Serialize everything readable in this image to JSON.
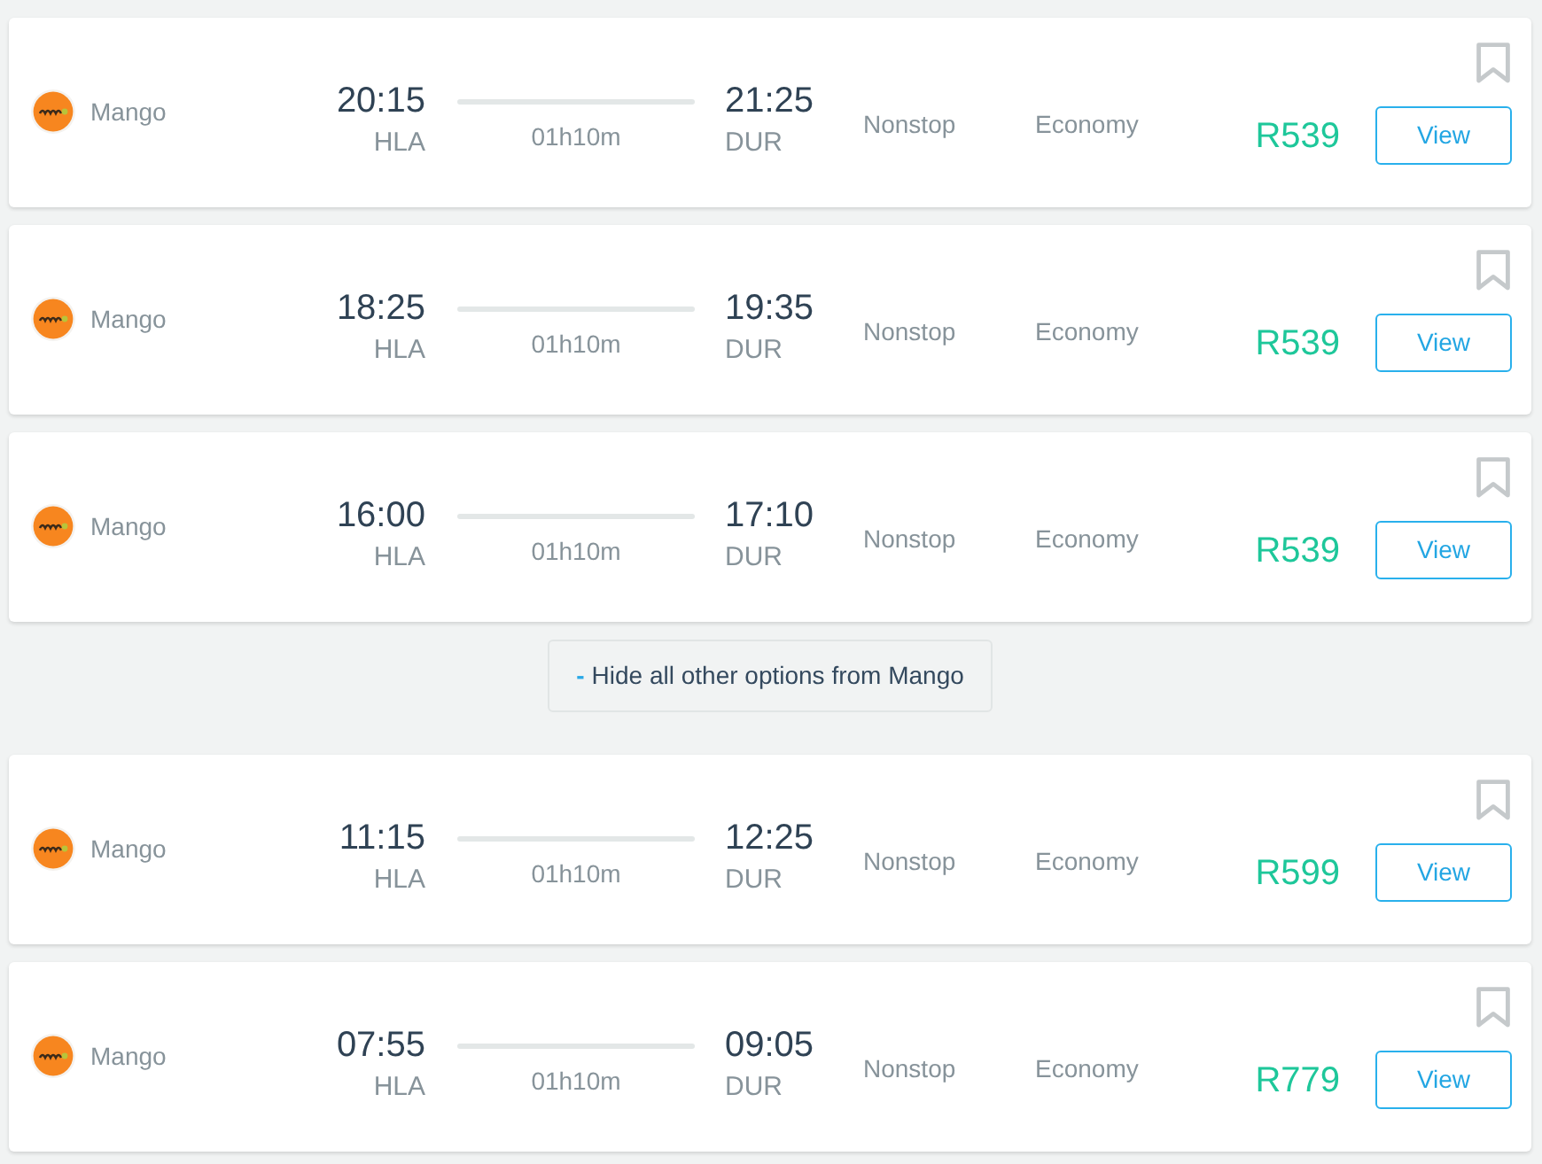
{
  "results": [
    {
      "kind": "flight",
      "airline": "Mango",
      "departure_time": "20:15",
      "departure_airport": "HLA",
      "duration": "01h10m",
      "arrival_time": "21:25",
      "arrival_airport": "DUR",
      "stops": "Nonstop",
      "cabin": "Economy",
      "price": "R539",
      "action": "View",
      "bookmarked": false
    },
    {
      "kind": "flight",
      "airline": "Mango",
      "departure_time": "18:25",
      "departure_airport": "HLA",
      "duration": "01h10m",
      "arrival_time": "19:35",
      "arrival_airport": "DUR",
      "stops": "Nonstop",
      "cabin": "Economy",
      "price": "R539",
      "action": "View",
      "bookmarked": false
    },
    {
      "kind": "flight",
      "airline": "Mango",
      "departure_time": "16:00",
      "departure_airport": "HLA",
      "duration": "01h10m",
      "arrival_time": "17:10",
      "arrival_airport": "DUR",
      "stops": "Nonstop",
      "cabin": "Economy",
      "price": "R539",
      "action": "View",
      "bookmarked": false
    },
    {
      "kind": "toggle",
      "icon": "-",
      "label": "Hide all other options from Mango"
    },
    {
      "kind": "flight",
      "airline": "Mango",
      "departure_time": "11:15",
      "departure_airport": "HLA",
      "duration": "01h10m",
      "arrival_time": "12:25",
      "arrival_airport": "DUR",
      "stops": "Nonstop",
      "cabin": "Economy",
      "price": "R599",
      "action": "View",
      "bookmarked": false
    },
    {
      "kind": "flight",
      "airline": "Mango",
      "departure_time": "07:55",
      "departure_airport": "HLA",
      "duration": "01h10m",
      "arrival_time": "09:05",
      "arrival_airport": "DUR",
      "stops": "Nonstop",
      "cabin": "Economy",
      "price": "R779",
      "action": "View",
      "bookmarked": false
    }
  ]
}
